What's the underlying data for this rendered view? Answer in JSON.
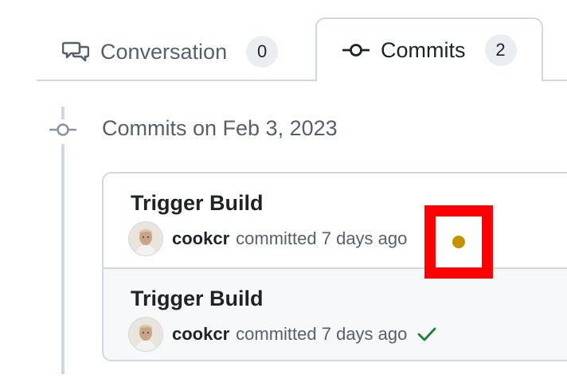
{
  "tabs": [
    {
      "label": "Conversation",
      "count": "0",
      "icon": "comment-discussion-icon",
      "selected": false
    },
    {
      "label": "Commits",
      "count": "2",
      "icon": "git-commit-icon",
      "selected": true
    }
  ],
  "timeline": {
    "date_header": "Commits on Feb 3, 2023"
  },
  "commits": [
    {
      "title": "Trigger Build",
      "author": "cookcr",
      "action_text": "committed 7 days ago",
      "status": "pending",
      "status_color": "#c69200",
      "highlighted": true
    },
    {
      "title": "Trigger Build",
      "author": "cookcr",
      "action_text": "committed 7 days ago",
      "status": "success",
      "status_color": "#1a7f37",
      "highlighted": false
    }
  ],
  "colors": {
    "border": "#d0d7de",
    "muted_text": "#57606a",
    "text": "#1f2328",
    "highlight": "#ff0000",
    "counter_bg": "#eaeef2"
  }
}
